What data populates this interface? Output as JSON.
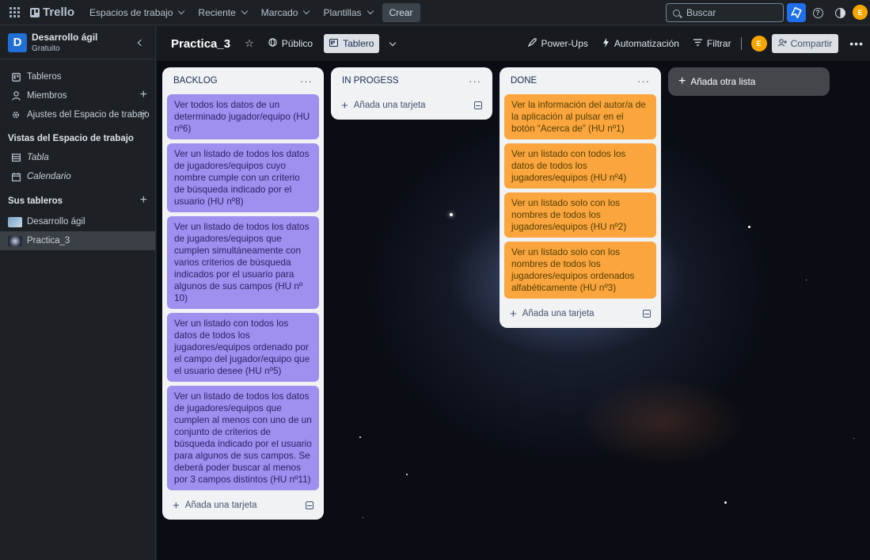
{
  "topbar": {
    "logo": "Trello",
    "nav": [
      {
        "label": "Espacios de trabajo"
      },
      {
        "label": "Reciente"
      },
      {
        "label": "Marcado"
      },
      {
        "label": "Plantillas"
      }
    ],
    "create_label": "Crear",
    "search_placeholder": "Buscar",
    "avatar_initial": "E"
  },
  "sidebar": {
    "workspace_initial": "D",
    "workspace_name": "Desarrollo ágil",
    "workspace_plan": "Gratuito",
    "items": [
      {
        "label": "Tableros"
      },
      {
        "label": "Miembros"
      },
      {
        "label": "Ajustes del Espacio de trabajo"
      }
    ],
    "views_title": "Vistas del Espacio de trabajo",
    "views": [
      {
        "label": "Tabla"
      },
      {
        "label": "Calendario"
      }
    ],
    "boards_title": "Sus tableros",
    "boards": [
      {
        "label": "Desarrollo ágil"
      },
      {
        "label": "Practica_3"
      }
    ]
  },
  "board": {
    "title": "Practica_3",
    "visibility": "Público",
    "view": "Tablero",
    "powerups": "Power-Ups",
    "automation": "Automatización",
    "filter": "Filtrar",
    "avatar_initial": "E",
    "share": "Compartir",
    "add_list": "Añada otra lista",
    "add_card": "Añada una tarjeta"
  },
  "lists": [
    {
      "title": "BACKLOG",
      "cards": [
        "Ver todos los datos de un determinado jugador/equipo (HU nº6)",
        "Ver un listado de todos los datos de jugadores/equipos cuyo nombre cumple con un criterio de búsqueda indicado por el usuario (HU nº8)",
        "Ver un listado de todos los datos de jugadores/equipos que cumplen simultáneamente con varios criterios de búsqueda indicados por el usuario para algunos de sus campos (HU nº 10)",
        "Ver un listado con todos los datos de todos los jugadores/equipos ordenado por el campo del jugador/equipo que el usuario desee (HU nº5)",
        "Ver un listado de todos los datos de jugadores/equipos que cumplen al menos con uno de un conjunto de criterios de búsqueda indicado por el usuario para algunos de sus campos. Se deberá poder buscar al menos por 3 campos distintos (HU nº11)"
      ]
    },
    {
      "title": "IN PROGESS",
      "cards": []
    },
    {
      "title": "DONE",
      "cards": [
        "Ver la información del autor/a de la aplicación al pulsar en el botón “Acerca de” (HU nº1)",
        "Ver un listado con todos los datos de todos los jugadores/equipos (HU nº4)",
        "Ver un listado solo con los nombres de todos los jugadores/equipos (HU nº2)",
        "Ver un listado solo con los nombres de todos los jugadores/equipos ordenados alfabéticamente (HU nº3)"
      ]
    }
  ],
  "colors": {
    "backlog_card": "#9f8fef",
    "done_card": "#faa53d",
    "accent": "#1f6feb"
  }
}
